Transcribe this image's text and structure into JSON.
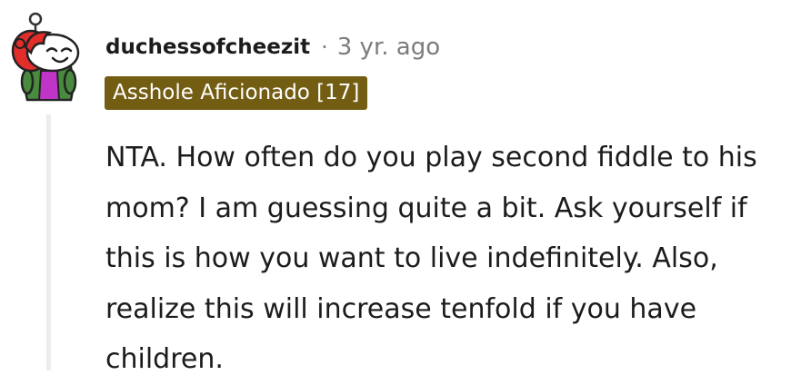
{
  "comment": {
    "username": "duchessofcheezit",
    "separator": "·",
    "timestamp": "3 yr. ago",
    "flair": "Asshole Aficionado [17]",
    "body": "NTA. How often do you play second fiddle to his mom? I am guessing quite a bit. Ask yourself if this is how you want to live indefinitely. Also, realize this will increase tenfold if you have children."
  },
  "colors": {
    "flair_background": "#735d12",
    "flair_text": "#ffffff",
    "username": "#1c1c1c",
    "metadata": "#7c7c7c",
    "body_text": "#1c1c1c",
    "thread_line": "#ececec",
    "avatar_hair": "#e32d2b",
    "avatar_jacket": "#4a8a3f",
    "avatar_shirt": "#c035c8"
  },
  "icons": {
    "avatar": "snoo-avatar-red-hair-green-jacket"
  }
}
